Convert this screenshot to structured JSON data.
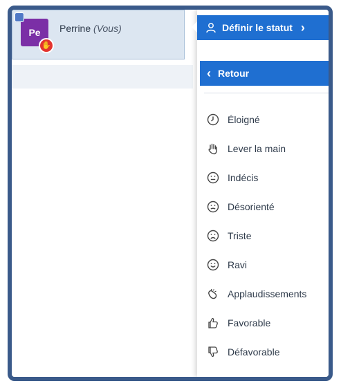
{
  "participant": {
    "initials": "Pe",
    "name": "Perrine",
    "self_suffix": "(Vous)"
  },
  "menu": {
    "set_status_label": "Définir le statut",
    "back_label": "Retour",
    "statuses": [
      {
        "label": "Éloigné",
        "icon": "clock-icon"
      },
      {
        "label": "Lever la main",
        "icon": "raise-hand-icon"
      },
      {
        "label": "Indécis",
        "icon": "undecided-face-icon"
      },
      {
        "label": "Désorienté",
        "icon": "confused-face-icon"
      },
      {
        "label": "Triste",
        "icon": "sad-face-icon"
      },
      {
        "label": "Ravi",
        "icon": "happy-face-icon"
      },
      {
        "label": "Applaudissements",
        "icon": "applause-icon"
      },
      {
        "label": "Favorable",
        "icon": "thumbs-up-icon"
      },
      {
        "label": "Défavorable",
        "icon": "thumbs-down-icon"
      }
    ]
  },
  "colors": {
    "accent": "#1f6fd1",
    "frame": "#3a5a8a",
    "avatar": "#7b2fa6",
    "hand_badge": "#e3342f",
    "selected_row": "#dce6f1"
  }
}
